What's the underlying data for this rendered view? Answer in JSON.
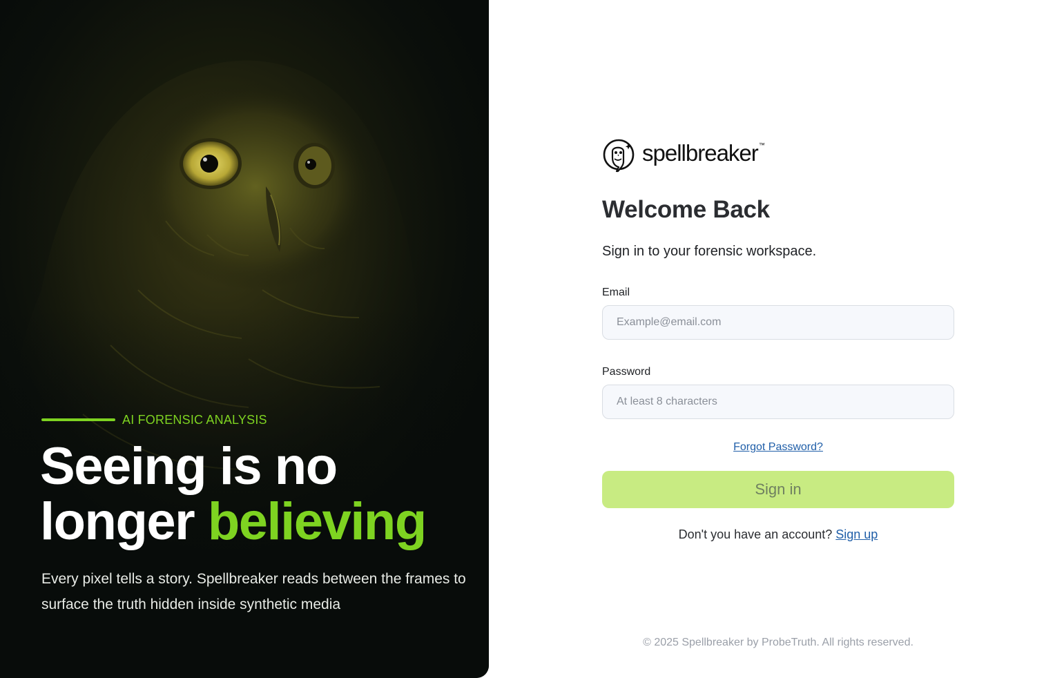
{
  "colors": {
    "accent": "#7ed321",
    "hero_bg": "#0b0f0b",
    "button_bg": "#c8eb82",
    "link": "#1f5ea8"
  },
  "hero": {
    "eyebrow": "AI FORENSIC ANALYSIS",
    "headline_line1": "Seeing is no",
    "headline_line2_plain": "longer ",
    "headline_line2_accent": "believing",
    "copy": "Every pixel tells a story. Spellbreaker reads between the frames to surface the truth hidden inside synthetic media",
    "image": "owl-photo"
  },
  "brand": {
    "logo_icon": "owl-logo-icon",
    "name": "spellbreaker",
    "tm": "™"
  },
  "form": {
    "title": "Welcome Back",
    "subtitle": "Sign in to your forensic workspace.",
    "email_label": "Email",
    "email_placeholder": "Example@email.com",
    "email_value": "",
    "password_label": "Password",
    "password_placeholder": "At least 8 characters",
    "password_value": "",
    "forgot_link": "Forgot Password?",
    "signin_label": "Sign in",
    "signup_prompt": "Don't you have an account?",
    "signup_link": "Sign up"
  },
  "footer": {
    "copyright": "© 2025 Spellbreaker by ProbeTruth. All rights reserved."
  }
}
